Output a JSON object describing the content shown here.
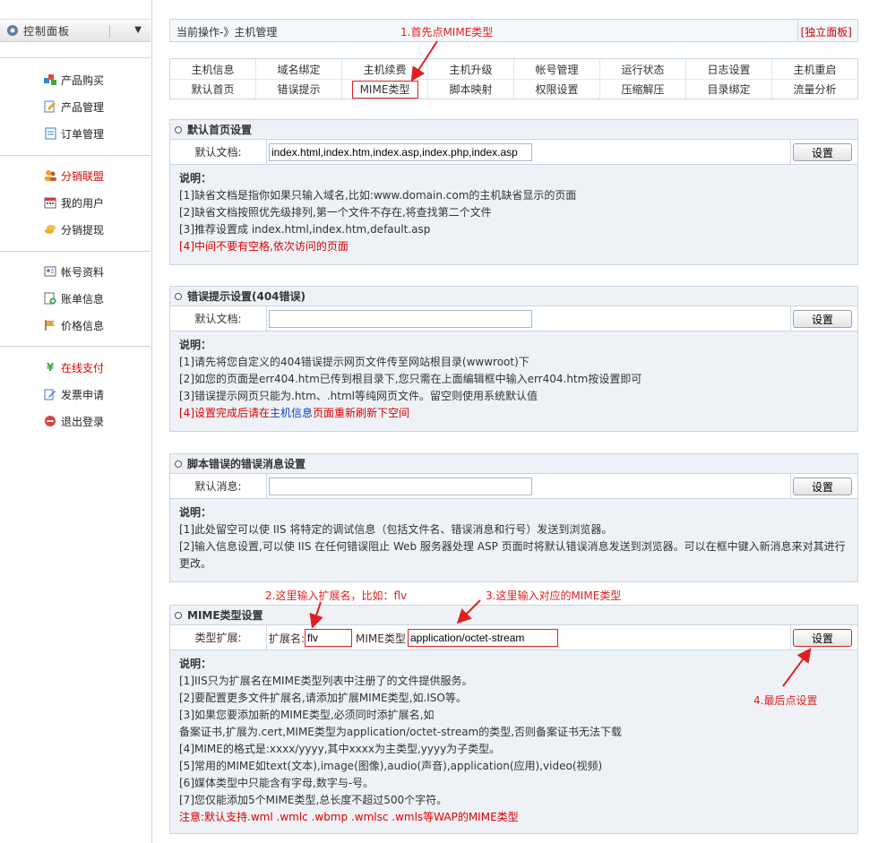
{
  "sidebar": {
    "header_title": "控制面板",
    "items": [
      {
        "label": "产品购买",
        "icon": "cubes-icon"
      },
      {
        "label": "产品管理",
        "icon": "edit-doc-icon"
      },
      {
        "label": "订单管理",
        "icon": "document-icon"
      },
      {
        "label": "分销联盟",
        "icon": "users-icon"
      },
      {
        "label": "我的用户",
        "icon": "calendar-grid-icon"
      },
      {
        "label": "分销提现",
        "icon": "coins-icon"
      },
      {
        "label": "帐号资料",
        "icon": "id-card-icon"
      },
      {
        "label": "账单信息",
        "icon": "bill-plus-icon"
      },
      {
        "label": "价格信息",
        "icon": "flag-icon"
      },
      {
        "label": "在线支付",
        "icon": "yen-icon"
      },
      {
        "label": "发票申请",
        "icon": "pen-icon"
      },
      {
        "label": "退出登录",
        "icon": "exit-icon"
      }
    ]
  },
  "topbar": {
    "crumb": "当前操作-》主机管理",
    "independent": "[独立面板]"
  },
  "tabs_row1": [
    "主机信息",
    "域名绑定",
    "主机续费",
    "主机升级",
    "帐号管理",
    "运行状态",
    "日志设置",
    "主机重启"
  ],
  "tabs_row2": [
    "默认首页",
    "错误提示",
    "MIME类型",
    "脚本映射",
    "权限设置",
    "压缩解压",
    "目录绑定",
    "流量分析"
  ],
  "sec1": {
    "title": "默认首页设置",
    "label": "默认文档:",
    "value": "index.html,index.htm,index.asp,index.php,index.asp",
    "button": "设置",
    "desc_title": "说明：",
    "lines": [
      "[1]缺省文档是指你如果只输入域名,比如:www.domain.com的主机缺省显示的页面",
      "[2]缺省文档按照优先级排列,第一个文件不存在,将查找第二个文件",
      "[3]推荐设置成 index.html,index.htm,default.asp"
    ],
    "line4_prefix": "[4]",
    "line4_red": "中间不要有空格,依次访问的页面"
  },
  "sec2": {
    "title": "错误提示设置(404错误)",
    "label": "默认文档:",
    "value": "",
    "button": "设置",
    "desc_title": "说明：",
    "lines": [
      "[1]请先将您自定义的404错误提示网页文件传至网站根目录(wwwroot)下",
      "[2]如您的页面是err404.htm已传到根目录下,您只需在上面编辑框中输入err404.htm按设置即可",
      "[3]错误提示网页只能为.htm、.html等纯网页文件。留空则使用系统默认值"
    ],
    "line4_prefix": "[4]",
    "line4_red1": "设置完成后请在",
    "line4_blue": "主机信息",
    "line4_red2": "页面重新刷新下空间"
  },
  "sec3": {
    "title": "脚本错误的错误消息设置",
    "label": "默认消息:",
    "value": "",
    "button": "设置",
    "desc_title": "说明：",
    "lines": [
      "[1]此处留空可以使 IIS 将特定的调试信息（包括文件名、错误消息和行号）发送到浏览器。",
      "[2]输入信息设置,可以使 IIS 在任何错误阻止 Web 服务器处理 ASP 页面时将默认错误消息发送到浏览器。可以在框中键入新消息来对其进行",
      "更改。"
    ]
  },
  "sec4": {
    "title": "MIME类型设置",
    "label": "类型扩展:",
    "ext_label": "扩展名:",
    "ext_value": "flv",
    "mime_label": "MIME类型",
    "mime_value": "application/octet-stream",
    "button": "设置",
    "desc_title": "说明：",
    "lines": [
      "[1]IIS只为扩展名在MIME类型列表中注册了的文件提供服务。",
      "[2]要配置更多文件扩展名,请添加扩展MIME类型,如.ISO等。",
      "[3]如果您要添加新的MIME类型,必须同时添扩展名,如",
      "备案证书,扩展为.cert,MIME类型为application/octet-stream的类型,否则备案证书无法下载",
      "[4]MIME的格式是:xxxx/yyyy,其中xxxx为主类型,yyyy为子类型。",
      "[5]常用的MIME如text(文本),image(图像),audio(声音),application(应用),video(视频)",
      "[6]媒体类型中只能含有字母,数字与-号。",
      "[7]您仅能添加5个MIME类型,总长度不超过500个字符。"
    ],
    "note": "注意:默认支持.wml .wmlc .wbmp .wmlsc .wmls等WAP的MIME类型"
  },
  "annotations": {
    "a1": "1.首先点MIME类型",
    "a2": "2.这里输入扩展名，比如：flv",
    "a3": "3.这里输入对应的MIME类型",
    "a4": "4.最后点设置"
  },
  "colors": {
    "annotation": "#e02020",
    "border": "#c6d6e6",
    "desc_bg": "#eef2f6",
    "link_red": "#dd0000"
  }
}
